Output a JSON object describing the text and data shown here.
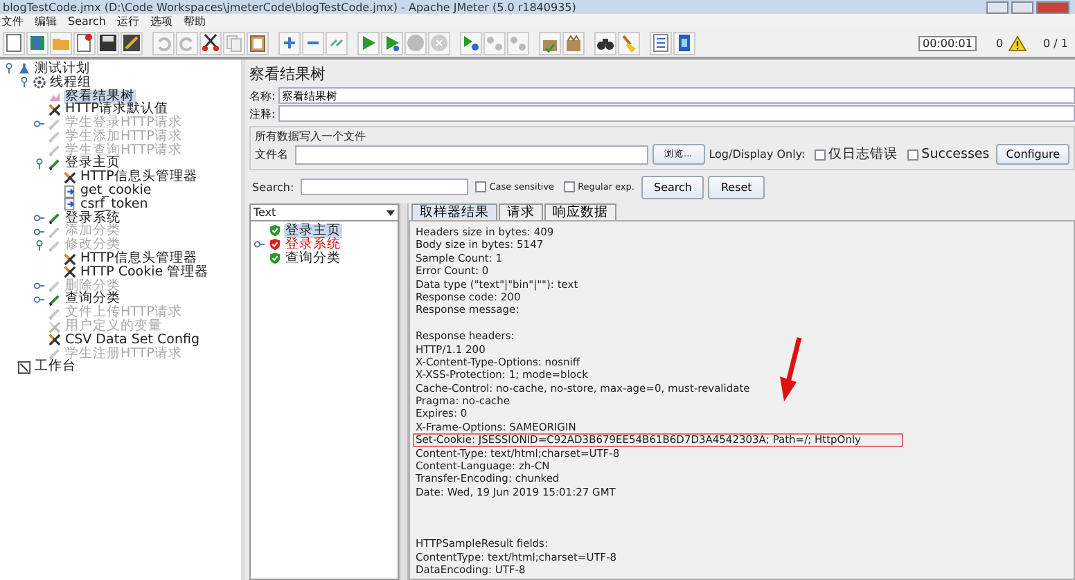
{
  "window": {
    "title": "blogTestCode.jmx (D:\\Code Workspaces\\jmeterCode\\blogTestCode.jmx) - Apache JMeter (5.0 r1840935)"
  },
  "menu": [
    "文件",
    "编辑",
    "Search",
    "运行",
    "选项",
    "帮助"
  ],
  "status": {
    "timer": "00:00:01",
    "warnings": "0",
    "threads": "0 / 1"
  },
  "tree": [
    {
      "label": "测试计划",
      "kind": "plan",
      "selected": false,
      "disabled": false,
      "expanded": true,
      "children": [
        {
          "label": "线程组",
          "kind": "threadgroup",
          "selected": false,
          "disabled": false,
          "expanded": true,
          "children": [
            {
              "label": "察看结果树",
              "kind": "listener",
              "selected": true,
              "disabled": false
            },
            {
              "label": "HTTP请求默认值",
              "kind": "config",
              "selected": false,
              "disabled": false
            },
            {
              "label": "学生登录HTTP请求",
              "kind": "sampler",
              "selected": false,
              "disabled": true,
              "expanded": false
            },
            {
              "label": "学生添加HTTP请求",
              "kind": "sampler",
              "selected": false,
              "disabled": true
            },
            {
              "label": "学生查询HTTP请求",
              "kind": "sampler",
              "selected": false,
              "disabled": true
            },
            {
              "label": "登录主页",
              "kind": "sampler",
              "selected": false,
              "disabled": false,
              "expanded": true,
              "children": [
                {
                  "label": "HTTP信息头管理器",
                  "kind": "config",
                  "selected": false,
                  "disabled": false
                },
                {
                  "label": "get_cookie",
                  "kind": "processor",
                  "selected": false,
                  "disabled": false
                },
                {
                  "label": "csrf_token",
                  "kind": "processor",
                  "selected": false,
                  "disabled": false
                }
              ]
            },
            {
              "label": "登录系统",
              "kind": "sampler",
              "selected": false,
              "disabled": false,
              "expanded": false
            },
            {
              "label": "添加分类",
              "kind": "sampler",
              "selected": false,
              "disabled": true,
              "expanded": false
            },
            {
              "label": "修改分类",
              "kind": "sampler",
              "selected": false,
              "disabled": true,
              "expanded": true,
              "children": [
                {
                  "label": "HTTP信息头管理器",
                  "kind": "config",
                  "selected": false,
                  "disabled": false
                },
                {
                  "label": "HTTP Cookie 管理器",
                  "kind": "config",
                  "selected": false,
                  "disabled": false
                }
              ]
            },
            {
              "label": "删除分类",
              "kind": "sampler",
              "selected": false,
              "disabled": true,
              "expanded": false
            },
            {
              "label": "查询分类",
              "kind": "sampler",
              "selected": false,
              "disabled": false,
              "expanded": false
            },
            {
              "label": "文件上传HTTP请求",
              "kind": "sampler",
              "selected": false,
              "disabled": true
            },
            {
              "label": "用户定义的变量",
              "kind": "config",
              "selected": false,
              "disabled": true
            },
            {
              "label": "CSV Data Set Config",
              "kind": "config",
              "selected": false,
              "disabled": false
            },
            {
              "label": "学生注册HTTP请求",
              "kind": "sampler",
              "selected": false,
              "disabled": true
            }
          ]
        }
      ]
    },
    {
      "label": "工作台",
      "kind": "workbench",
      "selected": false,
      "disabled": false
    }
  ],
  "panel": {
    "heading": "察看结果树",
    "name_label": "名称:",
    "name_value": "察看结果树",
    "comment_label": "注释:",
    "file_group": {
      "legend": "所有数据写入一个文件",
      "file_label": "文件名",
      "browse": "浏览...",
      "log_label": "Log/Display Only:",
      "options": [
        {
          "label": "仅日志错误",
          "checked": false
        },
        {
          "label": "Successes",
          "checked": false
        }
      ],
      "configure": "Configure"
    },
    "search": {
      "label": "Search:",
      "options": [
        {
          "label": "Case sensitive",
          "checked": false
        },
        {
          "label": "Regular exp.",
          "checked": false
        }
      ],
      "buttons": [
        "Search",
        "Reset"
      ]
    }
  },
  "results": {
    "renderer": "Text",
    "samples": [
      {
        "label": "登录主页",
        "kind": "success",
        "selected": true
      },
      {
        "label": "登录系统",
        "kind": "failure",
        "selected": false,
        "expanded": false
      },
      {
        "label": "查询分类",
        "kind": "success",
        "selected": false
      }
    ],
    "tabs": [
      {
        "label": "取样器结果",
        "selected": true
      },
      {
        "label": "请求",
        "selected": false
      },
      {
        "label": "响应数据",
        "selected": false
      }
    ],
    "sections": [
      {
        "lines": [
          {
            "text": "Headers size in bytes: 409",
            "highlighted": false
          },
          {
            "text": "Body size in bytes: 5147",
            "highlighted": false
          },
          {
            "text": "Sample Count: 1",
            "highlighted": false
          },
          {
            "text": "Error Count: 0",
            "highlighted": false
          },
          {
            "text": "Data type (\"text\"|\"bin\"|\"\"): text",
            "highlighted": false
          },
          {
            "text": "Response code: 200",
            "highlighted": false
          },
          {
            "text": "Response message:",
            "highlighted": false
          }
        ]
      },
      {
        "lines": [
          {
            "text": "Response headers:",
            "highlighted": false
          },
          {
            "text": "HTTP/1.1 200",
            "highlighted": false
          },
          {
            "text": "X-Content-Type-Options: nosniff",
            "highlighted": false
          },
          {
            "text": "X-XSS-Protection: 1; mode=block",
            "highlighted": false
          },
          {
            "text": "Cache-Control: no-cache, no-store, max-age=0, must-revalidate",
            "highlighted": false
          },
          {
            "text": "Pragma: no-cache",
            "highlighted": false
          },
          {
            "text": "Expires: 0",
            "highlighted": false
          },
          {
            "text": "X-Frame-Options: SAMEORIGIN",
            "highlighted": false
          },
          {
            "text": "Set-Cookie: JSESSIONID=C92AD3B679EE54B61B6D7D3A4542303A; Path=/; HttpOnly",
            "highlighted": true
          },
          {
            "text": "Content-Type: text/html;charset=UTF-8",
            "highlighted": false
          },
          {
            "text": "Content-Language: zh-CN",
            "highlighted": false
          },
          {
            "text": "Transfer-Encoding: chunked",
            "highlighted": false
          },
          {
            "text": "Date: Wed, 19 Jun 2019 15:01:27 GMT",
            "highlighted": false
          }
        ]
      },
      {
        "lines": [
          {
            "text": "HTTPSampleResult fields:",
            "highlighted": false
          },
          {
            "text": "ContentType: text/html;charset=UTF-8",
            "highlighted": false
          },
          {
            "text": "DataEncoding: UTF-8",
            "highlighted": false
          }
        ]
      }
    ]
  }
}
